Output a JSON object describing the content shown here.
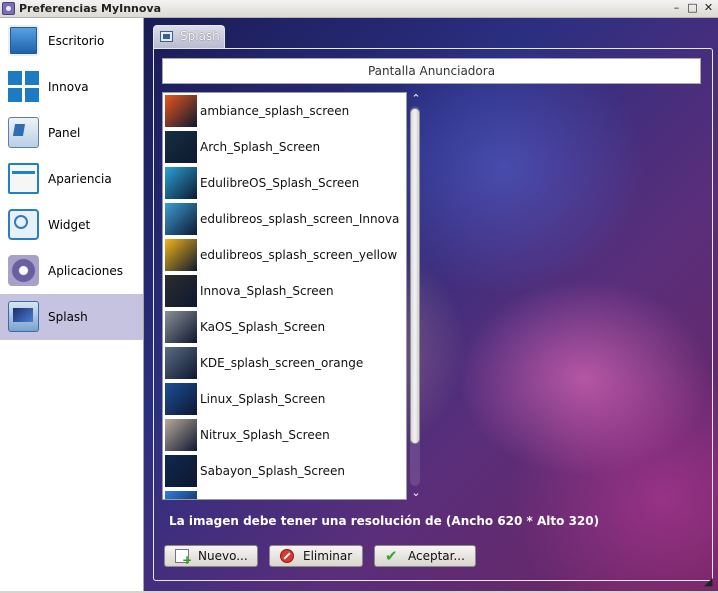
{
  "window": {
    "title": "Preferencias MyInnova",
    "controls": [
      "–",
      "□",
      "✕"
    ]
  },
  "sidebar": {
    "items": [
      {
        "label": "Escritorio",
        "icon": "desktop-icon"
      },
      {
        "label": "Innova",
        "icon": "innova-grid-icon"
      },
      {
        "label": "Panel",
        "icon": "panel-icon"
      },
      {
        "label": "Apariencia",
        "icon": "appearance-icon"
      },
      {
        "label": "Widget",
        "icon": "widget-icon"
      },
      {
        "label": "Aplicaciones",
        "icon": "applications-gear-icon"
      },
      {
        "label": "Splash",
        "icon": "splash-icon",
        "selected": true
      }
    ]
  },
  "tab": {
    "label": "Splash"
  },
  "header": {
    "title": "Pantalla Anunciadora"
  },
  "splash_list": {
    "items": [
      {
        "name": "ambiance_splash_screen",
        "color": "#e8561f"
      },
      {
        "name": "Arch_Splash_Screen",
        "color": "#16303f"
      },
      {
        "name": "EdulibreOS_Splash_Screen",
        "color": "#2aa3d8"
      },
      {
        "name": "edulibreos_splash_screen_Innova",
        "color": "#3c9ed3"
      },
      {
        "name": "edulibreos_splash_screen_yellow",
        "color": "#f2b417"
      },
      {
        "name": "Innova_Splash_Screen",
        "color": "#2d2d2d"
      },
      {
        "name": "KaOS_Splash_Screen",
        "color": "#8a8f96"
      },
      {
        "name": "KDE_splash_screen_orange",
        "color": "#5a6b82"
      },
      {
        "name": "Linux_Splash_Screen",
        "color": "#1d4f9a"
      },
      {
        "name": "Nitrux_Splash_Screen",
        "color": "#b9a99a"
      },
      {
        "name": "Sabayon_Splash_Screen",
        "color": "#10284e"
      },
      {
        "name": "",
        "color": "#2f7de0"
      }
    ]
  },
  "scrollbar": {
    "up": "⌃",
    "down": "⌄"
  },
  "note": "La imagen debe tener una resolución de (Ancho 620 * Alto 320)",
  "buttons": {
    "new": "Nuevo...",
    "delete": "Eliminar",
    "accept": "Aceptar..."
  }
}
